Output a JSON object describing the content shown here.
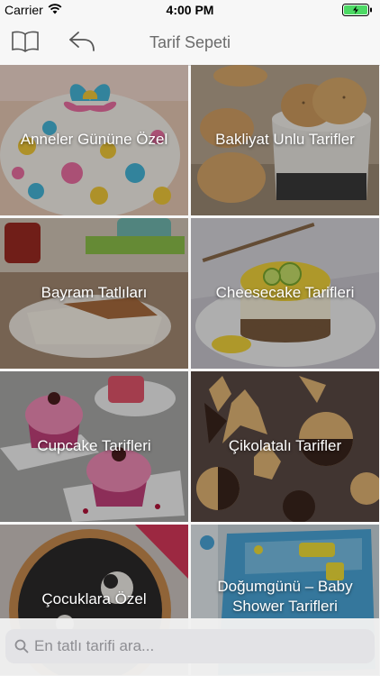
{
  "status_bar": {
    "carrier": "Carrier",
    "time": "4:00 PM",
    "battery_level": 1.0,
    "battery_color": "#4cd964"
  },
  "nav": {
    "title": "Tarif Sepeti",
    "left_icons": [
      "book-icon",
      "back-arrow-icon"
    ]
  },
  "categories": [
    {
      "label": "Anneler Gününe Özel"
    },
    {
      "label": "Bakliyat Unlu Tarifler"
    },
    {
      "label": "Bayram Tatlıları"
    },
    {
      "label": "Cheesecake Tarifleri"
    },
    {
      "label": "Cupcake Tarifleri"
    },
    {
      "label": "Çikolatalı Tarifler"
    },
    {
      "label": "Çocuklara Özel"
    },
    {
      "label_line1": "Doğumgünü – Baby",
      "label_line2": "Shower Tarifleri"
    }
  ],
  "search": {
    "placeholder": "En tatlı tarifi ara...",
    "value": ""
  }
}
